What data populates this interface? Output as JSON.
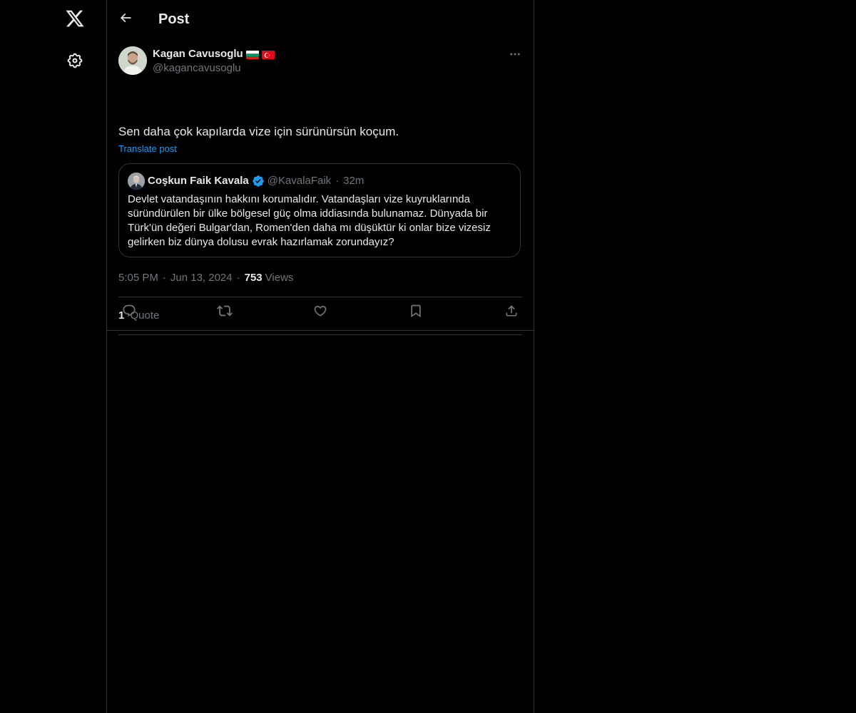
{
  "window": {
    "theme_background": "#000000",
    "accent_color": "#1d9bf0",
    "border_color": "#2f3336",
    "secondary_text_color": "#71767b"
  },
  "rail": {
    "items": [
      {
        "icon": "x-logo-icon"
      },
      {
        "icon": "gear-icon"
      }
    ]
  },
  "header": {
    "back_icon": "arrow-left-icon",
    "title": "Post"
  },
  "post": {
    "author_name": "Kagan Cavusoglu",
    "flags": [
      "bulgaria-flag-icon",
      "turkey-flag-icon"
    ],
    "author_handle": "@kagancavusoglu",
    "more_icon": "more-horizontal-icon",
    "text": "Sen daha çok kapılarda vize için sürünürsün koçum.",
    "translate_label": "Translate post",
    "quoted": {
      "author_name": "Coşkun Faik Kavala",
      "verified": true,
      "author_handle": "@KavalaFaik",
      "separator": "·",
      "time": "32m",
      "text": "Devlet vatandaşının hakkını korumalıdır. Vatandaşları vize kuyruklarında süründürülen bir ülke bölgesel güç olma iddiasında bulunamaz. Dünyada bir Türk'ün değeri Bulgar'dan, Romen'den daha mı düşüktür ki onlar bize vizesiz gelirken biz dünya dolusu evrak hazırlamak zorundayız?"
    },
    "time": "5:05 PM",
    "date": "Jun 13, 2024",
    "separator": "·",
    "views_count": "753",
    "views_label": "Views",
    "quote_count": "1",
    "quote_label": "Quote",
    "actions": [
      {
        "name": "reply-button",
        "icon": "reply-icon"
      },
      {
        "name": "repost-button",
        "icon": "repost-icon"
      },
      {
        "name": "like-button",
        "icon": "heart-icon"
      },
      {
        "name": "bookmark-button",
        "icon": "bookmark-icon"
      },
      {
        "name": "share-button",
        "icon": "share-icon"
      }
    ]
  }
}
